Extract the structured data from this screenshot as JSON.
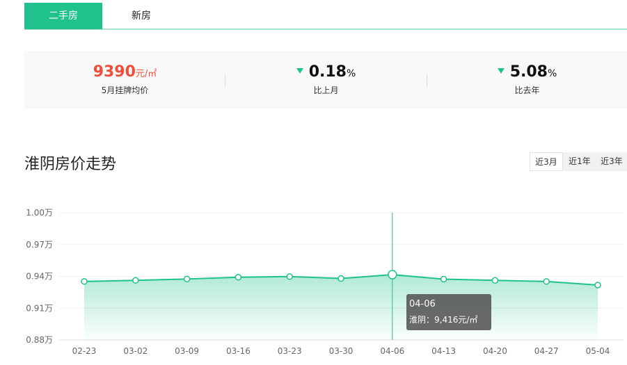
{
  "tabs": [
    {
      "label": "二手房",
      "active": true
    },
    {
      "label": "新房",
      "active": false
    }
  ],
  "stats": {
    "price": {
      "value": "9390",
      "unit": "元/㎡",
      "label": "5月挂牌均价"
    },
    "mom": {
      "value": "0.18",
      "unit": "%",
      "label": "比上月",
      "direction": "down"
    },
    "yoy": {
      "value": "5.08",
      "unit": "%",
      "label": "比去年",
      "direction": "down"
    }
  },
  "trend": {
    "title": "淮阴房价走势",
    "ranges": [
      {
        "label": "近3月",
        "active": true
      },
      {
        "label": "近1年",
        "active": false
      },
      {
        "label": "近3年",
        "active": false
      }
    ]
  },
  "tooltip": {
    "date": "04-06",
    "text": "淮阴：9,416元/㎡"
  },
  "colors": {
    "accent": "#1fc18c",
    "price": "#ef4f3a"
  },
  "chart_data": {
    "type": "area",
    "x": [
      "02-23",
      "03-02",
      "03-09",
      "03-16",
      "03-23",
      "03-30",
      "04-06",
      "04-13",
      "04-20",
      "04-27",
      "05-04"
    ],
    "series": [
      {
        "name": "淮阴",
        "values": [
          9352,
          9362,
          9375,
          9392,
          9398,
          9380,
          9416,
          9374,
          9362,
          9352,
          9318
        ]
      }
    ],
    "yticks": [
      8800,
      9100,
      9400,
      9700,
      10000
    ],
    "ytick_labels": [
      "0.88万",
      "0.91万",
      "0.94万",
      "0.97万",
      "1.00万"
    ],
    "ylim": [
      8800,
      10000
    ],
    "highlight_index": 6,
    "grid": true
  }
}
